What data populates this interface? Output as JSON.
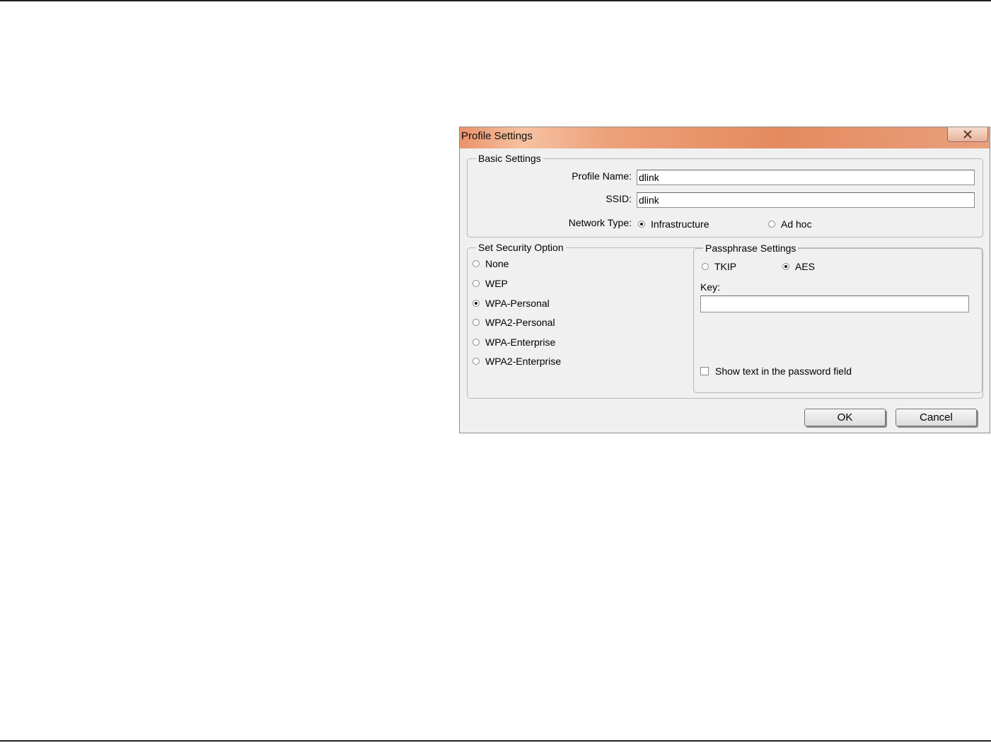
{
  "dialog": {
    "title": "Profile Settings",
    "close_icon": "close-icon",
    "basic_settings": {
      "legend": "Basic Settings",
      "profile_name_label": "Profile Name:",
      "profile_name_value": "dlink",
      "ssid_label": "SSID:",
      "ssid_value": "dlink",
      "network_type_label": "Network Type:",
      "network_types": [
        {
          "label": "Infrastructure",
          "checked": true
        },
        {
          "label": "Ad hoc",
          "checked": false
        }
      ]
    },
    "security": {
      "legend": "Set Security Option",
      "options": [
        {
          "label": "None",
          "checked": false
        },
        {
          "label": "WEP",
          "checked": false
        },
        {
          "label": "WPA-Personal",
          "checked": true
        },
        {
          "label": "WPA2-Personal",
          "checked": false
        },
        {
          "label": "WPA-Enterprise",
          "checked": false
        },
        {
          "label": "WPA2-Enterprise",
          "checked": false
        }
      ]
    },
    "passphrase": {
      "legend": "Passphrase Settings",
      "encryption": [
        {
          "label": "TKIP",
          "checked": false
        },
        {
          "label": "AES",
          "checked": true
        }
      ],
      "key_label": "Key:",
      "key_value": "",
      "show_text_label": "Show text in the password field",
      "show_text_checked": false
    },
    "buttons": {
      "ok": "OK",
      "cancel": "Cancel"
    }
  }
}
